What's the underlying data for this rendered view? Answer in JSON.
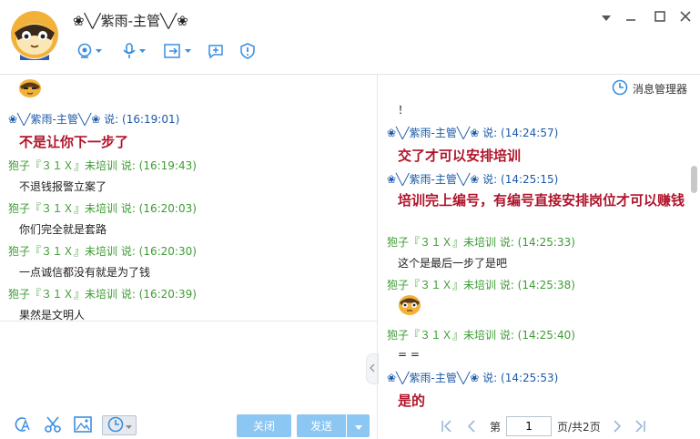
{
  "header": {
    "contact_name": "❀╲╱紫雨-主管╲╱❀",
    "toolbar": [
      "camera-icon",
      "microphone-icon",
      "send-file-icon",
      "remote-assist-icon",
      "security-shield-icon"
    ]
  },
  "window_controls": [
    "dropdown-icon",
    "minimize-icon",
    "maximize-icon",
    "close-icon"
  ],
  "left_chat": {
    "messages": [
      {
        "sender": "❀╲╱紫雨-主管╲╱❀ 说: (16:19:01)",
        "text": "不是让你下一步了",
        "style": "big",
        "color": "blue"
      },
      {
        "sender": "狍子『３１Ｘ』未培训 说: (16:19:43)",
        "text": "不退钱报警立案了",
        "style": "normal",
        "color": "green"
      },
      {
        "sender": "狍子『３１Ｘ』未培训 说: (16:20:03)",
        "text": "你们完全就是套路",
        "style": "normal",
        "color": "green"
      },
      {
        "sender": "狍子『３１Ｘ』未培训 说: (16:20:30)",
        "text": "一点诚信都没有就是为了钱",
        "style": "normal",
        "color": "green"
      },
      {
        "sender": "狍子『３１Ｘ』未培训 说: (16:20:39)",
        "text": "果然是文明人",
        "style": "normal",
        "color": "green"
      }
    ]
  },
  "bottom_toolbar": {
    "icons": [
      "font-icon",
      "screenshot-scissors-icon",
      "image-icon",
      "history-clock-icon"
    ],
    "close_label": "关闭",
    "send_label": "发送"
  },
  "right_panel": {
    "message_manager_label": "消息管理器",
    "top_fragment": "！",
    "messages": [
      {
        "sender": "❀╲╱紫雨-主管╲╱❀ 说: (14:24:57)",
        "text": "交了才可以安排培训",
        "style": "big",
        "color": "blue"
      },
      {
        "sender": "❀╲╱紫雨-主管╲╱❀ 说: (14:25:15)",
        "text": "培训完上编号，有编号直接安排岗位才可以赚钱",
        "style": "big",
        "color": "blue"
      },
      {
        "sender": "狍子『３１Ｘ』未培训 说: (14:25:33)",
        "text": "这个是最后一步了是吧",
        "style": "normal",
        "color": "green"
      },
      {
        "sender": "狍子『３１Ｘ』未培训 说: (14:25:38)",
        "text": "",
        "style": "emoji",
        "color": "green"
      },
      {
        "sender": "狍子『３１Ｘ』未培训 说: (14:25:40)",
        "text": "= =",
        "style": "normal",
        "color": "green"
      },
      {
        "sender": "❀╲╱紫雨-主管╲╱❀ 说: (14:25:53)",
        "text": "是的",
        "style": "big",
        "color": "blue"
      }
    ],
    "pager": {
      "prefix": "第",
      "page": "1",
      "suffix": "页/共2页"
    }
  }
}
